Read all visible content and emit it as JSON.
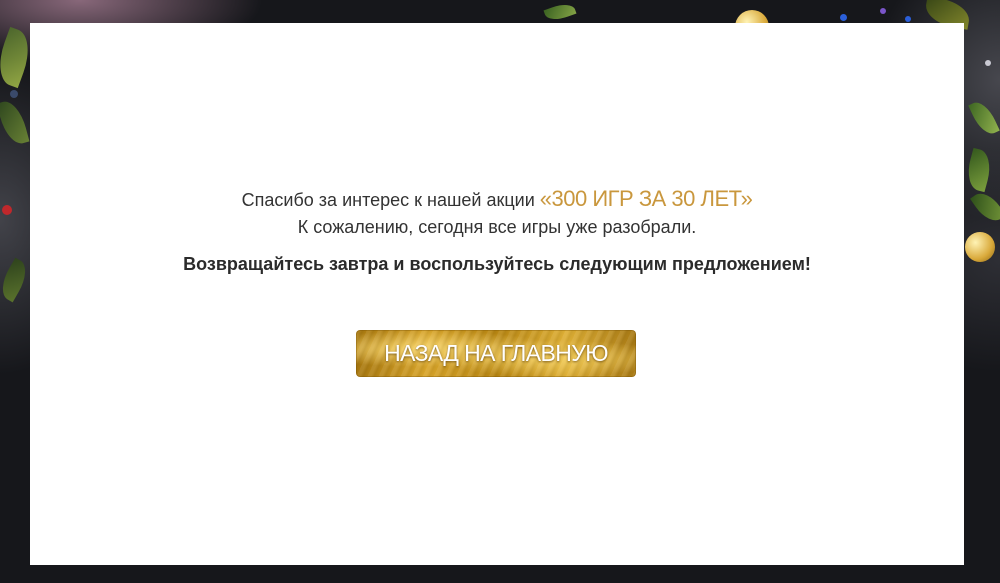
{
  "message": {
    "line1_text": "Спасибо за интерес к нашей акции ",
    "promo_name": "«300 ИГР ЗА 30 ЛЕТ»",
    "line2_text": "К сожалению, сегодня все игры уже разобрали.",
    "bold_line": "Возвращайтесь завтра и воспользуйтесь следующим предложением!"
  },
  "button": {
    "label": "НАЗАД НА ГЛАВНУЮ"
  },
  "colors": {
    "promo_accent": "#c9973d",
    "button_gold": "#d8a52b",
    "background_dark": "#16171b",
    "card_background": "#ffffff"
  }
}
